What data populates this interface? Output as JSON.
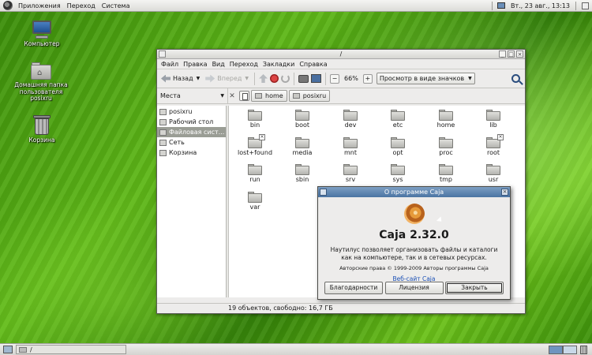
{
  "top_panel": {
    "menus": [
      "Приложения",
      "Переход",
      "Система"
    ],
    "clock": "Вт., 23 авг., 13:13"
  },
  "desktop": {
    "icons": [
      {
        "label": "Компьютер",
        "icon": "computer-icon"
      },
      {
        "label": "Домашняя папка пользователя posixru",
        "icon": "home-folder-icon"
      },
      {
        "label": "Корзина",
        "icon": "trash-icon"
      }
    ]
  },
  "window": {
    "title": "/",
    "menu": [
      "Файл",
      "Правка",
      "Вид",
      "Переход",
      "Закладки",
      "Справка"
    ],
    "toolbar": {
      "back": "Назад",
      "forward": "Вперед",
      "zoom": "66%",
      "view_mode": "Просмотр в виде значков"
    },
    "places_label": "Места",
    "breadcrumbs": [
      "home",
      "posixru"
    ],
    "sidebar": [
      {
        "label": "posixru",
        "selected": false
      },
      {
        "label": "Рабочий стол",
        "selected": false
      },
      {
        "label": "Файловая сист...",
        "selected": true
      },
      {
        "label": "Сеть",
        "selected": false
      },
      {
        "label": "Корзина",
        "selected": false
      }
    ],
    "files": [
      {
        "name": "bin",
        "locked": false
      },
      {
        "name": "boot",
        "locked": false
      },
      {
        "name": "dev",
        "locked": false
      },
      {
        "name": "etc",
        "locked": false
      },
      {
        "name": "home",
        "locked": false
      },
      {
        "name": "lib",
        "locked": false
      },
      {
        "name": "lost+found",
        "locked": true
      },
      {
        "name": "media",
        "locked": false
      },
      {
        "name": "mnt",
        "locked": false
      },
      {
        "name": "opt",
        "locked": false
      },
      {
        "name": "proc",
        "locked": false
      },
      {
        "name": "root",
        "locked": true
      },
      {
        "name": "run",
        "locked": false
      },
      {
        "name": "sbin",
        "locked": false
      },
      {
        "name": "srv",
        "locked": false
      },
      {
        "name": "sys",
        "locked": false
      },
      {
        "name": "tmp",
        "locked": false
      },
      {
        "name": "usr",
        "locked": false
      },
      {
        "name": "var",
        "locked": false
      }
    ],
    "status": "19 объектов, свободно: 16,7 ГБ"
  },
  "about": {
    "title": "О программе Caja",
    "name": "Caja 2.32.0",
    "description": "Наутилус позволяет организовать файлы и каталоги как на компьютере, так и в сетевых ресурсах.",
    "copyright": "Авторские права © 1999-2009 Авторы программы Caja",
    "website": "Веб-сайт Caja",
    "buttons": {
      "credits": "Благодарности",
      "license": "Лицензия",
      "close": "Закрыть"
    }
  },
  "bottom_panel": {
    "task": "/"
  }
}
